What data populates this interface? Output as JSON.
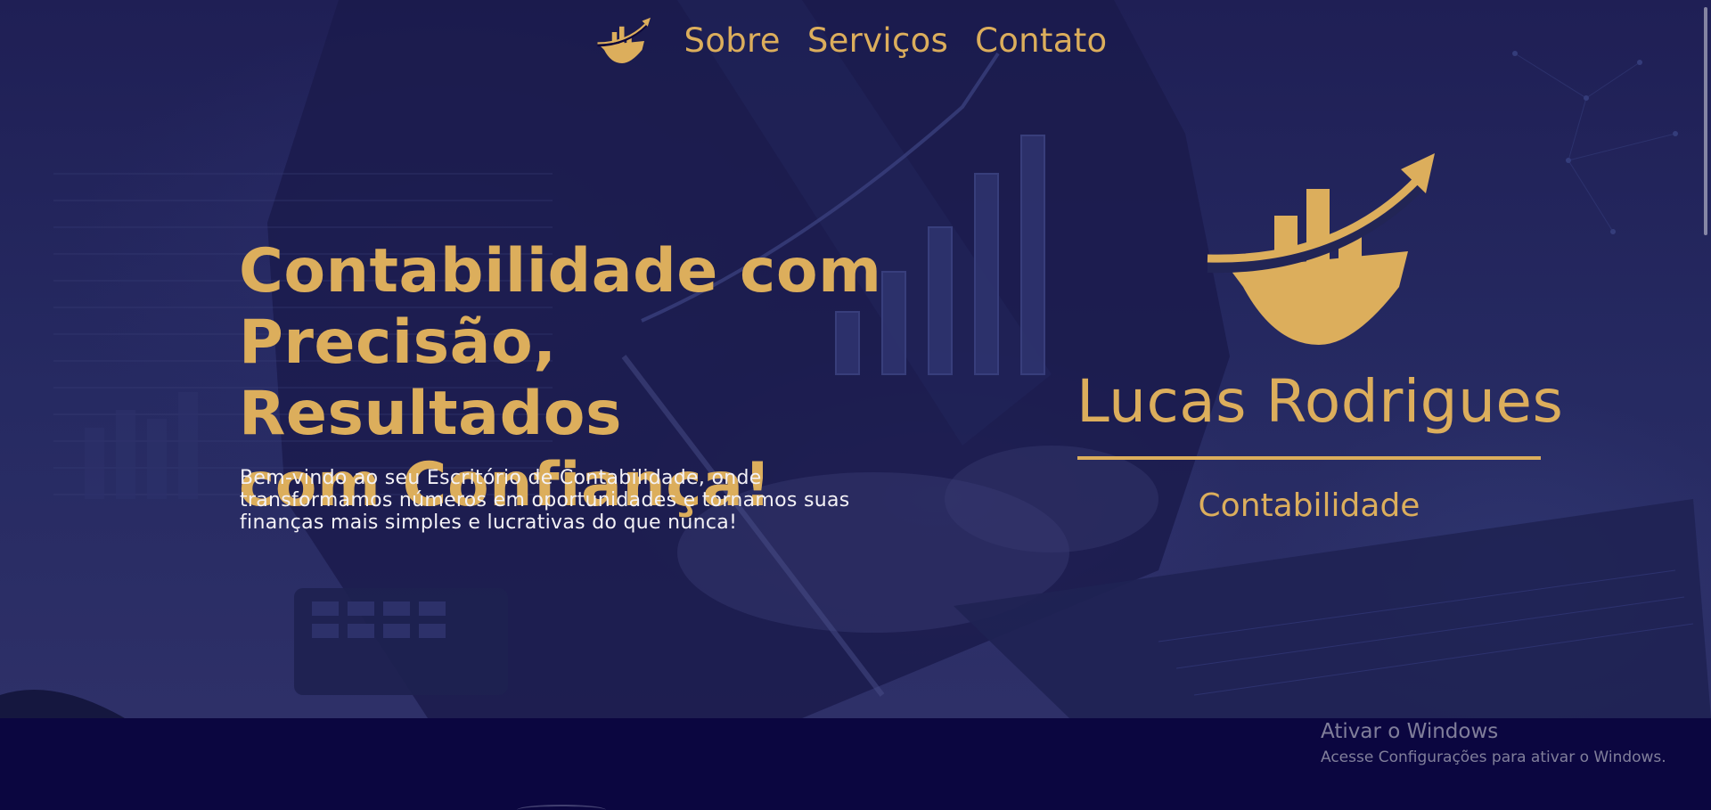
{
  "nav": {
    "logo_icon": "accounting-growth-logo-icon",
    "links": [
      "Sobre",
      "Serviços",
      "Contato"
    ]
  },
  "hero": {
    "headline": [
      "Contabilidade com",
      "Precisão, Resultados",
      "com Confiança!"
    ],
    "lead": "Bem-vindo ao seu Escritório de Contabilidade, onde transformamos números em oportunidades e tornamos suas finanças mais simples e lucrativas do que nunca!"
  },
  "brand": {
    "logo_icon": "accounting-growth-logo-icon",
    "name": "Lucas Rodrigues",
    "tagline": "Contabilidade"
  },
  "watermark": {
    "title": "Ativar o Windows",
    "subtitle": "Acesse Configurações para ativar o Windows."
  },
  "colors": {
    "accent_gold": "#dcae5c",
    "hero_overlay": "#262a62",
    "footer_bg": "#0b0640",
    "lead_text": "#f3f1f6"
  }
}
